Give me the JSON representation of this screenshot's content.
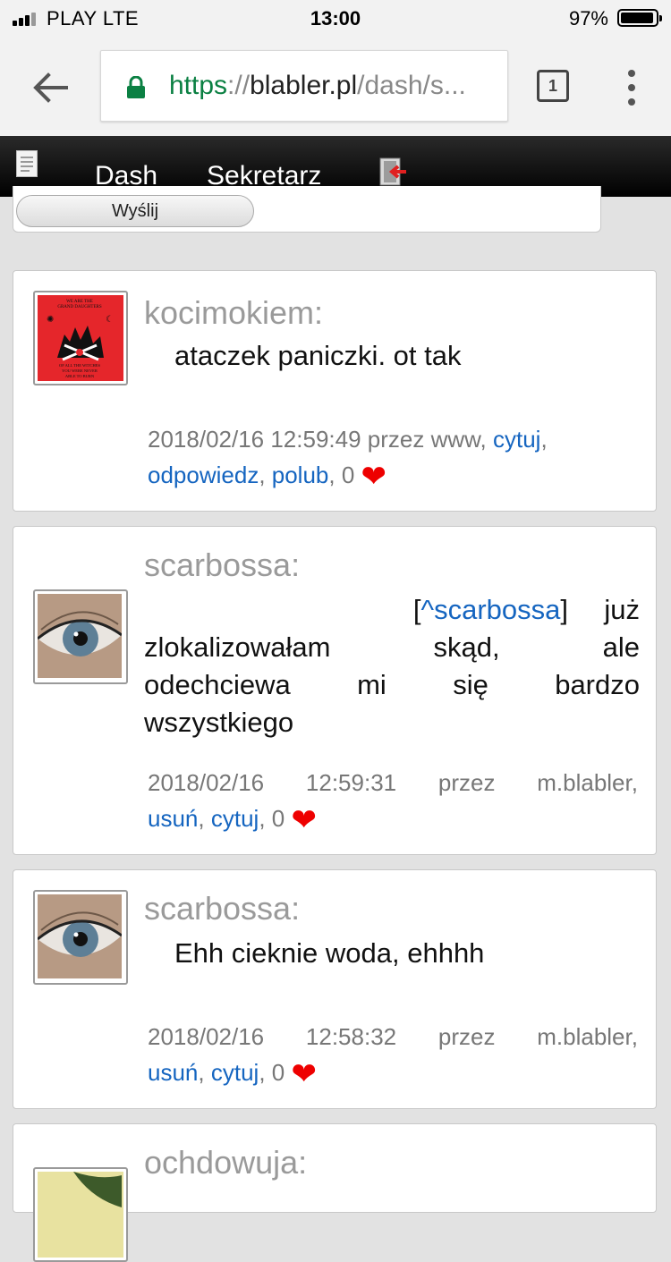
{
  "status_bar": {
    "carrier": "PLAY   LTE",
    "time": "13:00",
    "battery": "97%"
  },
  "browser": {
    "url_scheme": "https",
    "url_sep": "://",
    "url_domain": "blabler.pl",
    "url_path": "/dash/s...",
    "tab_count": "1"
  },
  "nav": {
    "dash": "Dash",
    "secretary": "Sekretarz"
  },
  "form": {
    "send_label": "Wyślij"
  },
  "posts": [
    {
      "author": "kocimokiem:",
      "message": "ataczek paniczki. ot tak",
      "datetime": "2018/02/16 12:59:49",
      "via_word": "przez",
      "via": "www,",
      "actions": [
        "cytuj",
        "odpowiedz",
        "polub"
      ],
      "likes": "0",
      "avatar_text": [
        "WE ARE THE",
        "GRAND DAUGHTERS",
        "OF ALL THE WITCHES",
        "YOU WERE NEVER",
        "ABLE TO BURN"
      ]
    },
    {
      "author": "scarbossa:",
      "reply_to": "^scarbossa",
      "message_words": [
        "już",
        "zlokalizowałam",
        "skąd,",
        "ale",
        "odechciewa",
        "mi",
        "się",
        "bardzo",
        "wszystkiego"
      ],
      "datetime_date": "2018/02/16",
      "datetime_time": "12:59:31",
      "via_word": "przez",
      "via": "m.blabler,",
      "actions": [
        "usuń",
        "cytuj"
      ],
      "likes": "0"
    },
    {
      "author": "scarbossa:",
      "message": "Ehh cieknie woda, ehhhh",
      "datetime_date": "2018/02/16",
      "datetime_time": "12:58:32",
      "via_word": "przez",
      "via": "m.blabler,",
      "actions": [
        "usuń",
        "cytuj"
      ],
      "likes": "0"
    },
    {
      "author": "ochdowuja:"
    }
  ],
  "colors": {
    "link": "#1565c0",
    "secure_green": "#0b8043",
    "heart": "#e00000",
    "author_gray": "#9a9a9a"
  },
  "icons": [
    "signal-icon",
    "battery-icon",
    "back-arrow-icon",
    "lock-icon",
    "tabs-icon",
    "overflow-menu-icon",
    "document-icon",
    "logout-icon",
    "heart-icon"
  ]
}
